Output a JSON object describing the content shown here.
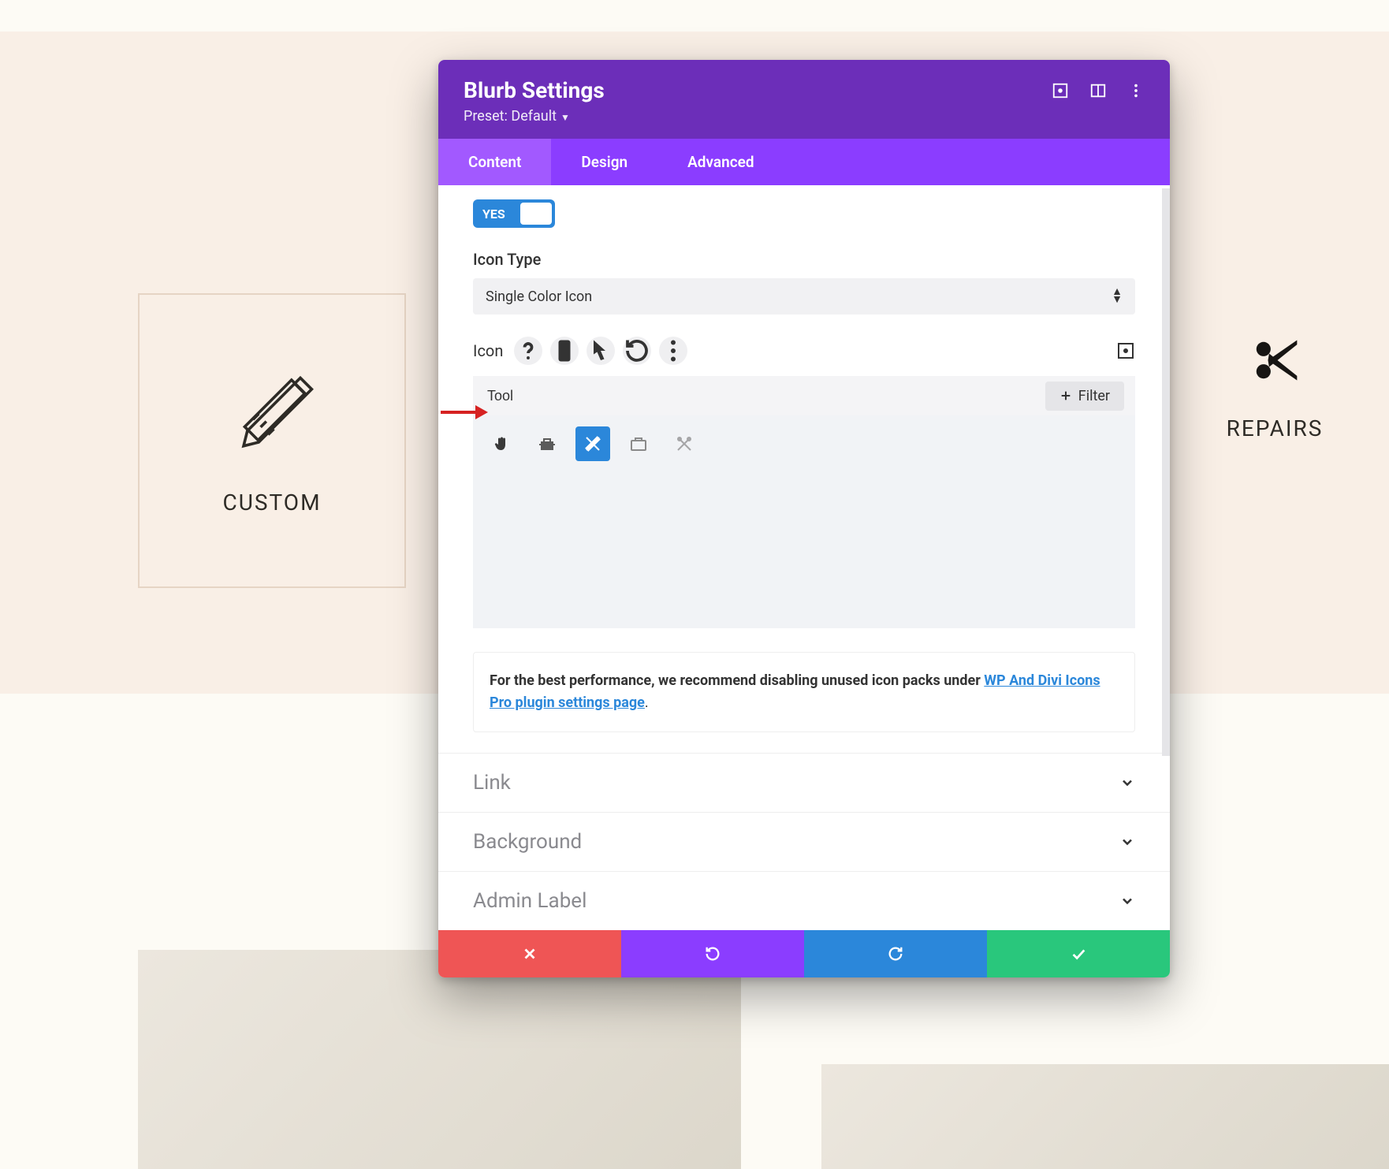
{
  "page": {
    "card_left_label": "CUSTOM",
    "card_right_label": "REPAIRS"
  },
  "modal": {
    "title": "Blurb Settings",
    "preset": "Preset: Default",
    "tabs": {
      "content": "Content",
      "design": "Design",
      "advanced": "Advanced"
    },
    "toggle_value": "YES",
    "fields": {
      "icon_type_label": "Icon Type",
      "icon_type_value": "Single Color Icon",
      "icon_label": "Icon",
      "icon_search_value": "Tool",
      "filter_button": "Filter"
    },
    "notice_prefix": "For the best performance, we recommend disabling unused icon packs under ",
    "notice_link": "WP And Divi Icons Pro plugin settings page",
    "notice_suffix": ".",
    "accordion": {
      "link": "Link",
      "background": "Background",
      "admin_label": "Admin Label"
    }
  }
}
